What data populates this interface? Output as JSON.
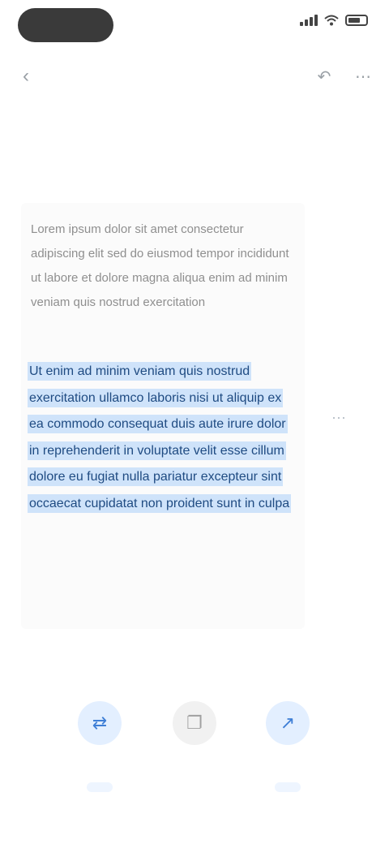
{
  "status_bar": {
    "time": ""
  },
  "app_bar": {
    "title": ""
  },
  "document": {
    "paragraphs": [
      "Lorem ipsum dolor sit amet consectetur adipiscing elit sed do eiusmod tempor incididunt ut labore et dolore magna aliqua enim ad minim veniam quis nostrud exercitation"
    ],
    "selected_text": "Ut enim ad minim veniam quis nostrud exercitation ullamco laboris nisi ut aliquip ex ea commodo consequat duis aute irure dolor in reprehenderit in voluptate velit esse cillum dolore eu fugiat nulla pariatur excepteur sint occaecat cupidatat non proident sunt in culpa"
  },
  "actions": {
    "left": {
      "label": "",
      "icon": "translate-icon"
    },
    "middle": {
      "icon": "copy-icon"
    },
    "right": {
      "label": "",
      "icon": "share-icon"
    }
  },
  "colors": {
    "selection": "#cfe3fa",
    "accent": "#3f7fd6"
  }
}
